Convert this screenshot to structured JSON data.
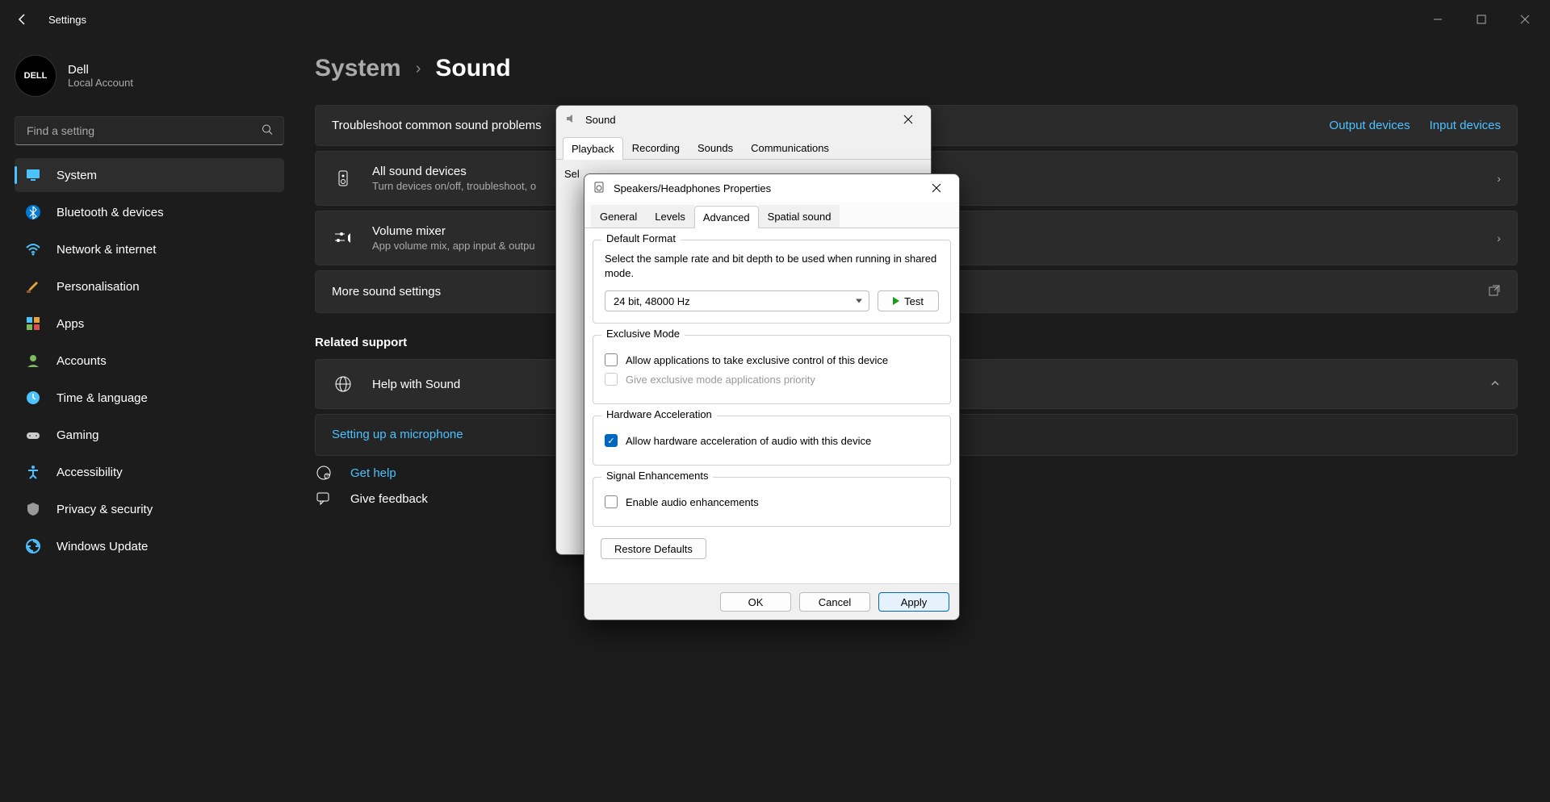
{
  "titlebar": {
    "title": "Settings"
  },
  "profile": {
    "name": "Dell",
    "sub": "Local Account",
    "avatar_text": "DELL"
  },
  "search": {
    "placeholder": "Find a setting"
  },
  "nav": [
    {
      "label": "System",
      "selected": true,
      "icon": "monitor"
    },
    {
      "label": "Bluetooth & devices",
      "icon": "bluetooth"
    },
    {
      "label": "Network & internet",
      "icon": "wifi"
    },
    {
      "label": "Personalisation",
      "icon": "brush"
    },
    {
      "label": "Apps",
      "icon": "apps"
    },
    {
      "label": "Accounts",
      "icon": "person"
    },
    {
      "label": "Time & language",
      "icon": "clock"
    },
    {
      "label": "Gaming",
      "icon": "gamepad"
    },
    {
      "label": "Accessibility",
      "icon": "accessibility"
    },
    {
      "label": "Privacy & security",
      "icon": "shield"
    },
    {
      "label": "Windows Update",
      "icon": "update"
    }
  ],
  "breadcrumb": {
    "parent": "System",
    "current": "Sound"
  },
  "troubleshoot": {
    "title": "Troubleshoot common sound problems",
    "link_output": "Output devices",
    "link_input": "Input devices"
  },
  "cards": {
    "all_devices": {
      "title": "All sound devices",
      "sub": "Turn devices on/off, troubleshoot, o"
    },
    "mixer": {
      "title": "Volume mixer",
      "sub": "App volume mix, app input & outpu"
    },
    "more": {
      "title": "More sound settings"
    }
  },
  "related": {
    "heading": "Related support",
    "help": "Help with Sound",
    "setup_mic": "Setting up a microphone",
    "get_help": "Get help",
    "feedback": "Give feedback"
  },
  "dlg_sound": {
    "title": "Sound",
    "tabs": [
      "Playback",
      "Recording",
      "Sounds",
      "Communications"
    ],
    "active_tab": 0,
    "body_hint": "Sel"
  },
  "dlg_props": {
    "title": "Speakers/Headphones Properties",
    "tabs": [
      "General",
      "Levels",
      "Advanced",
      "Spatial sound"
    ],
    "active_tab": 2,
    "groups": {
      "default_format": {
        "label": "Default Format",
        "desc": "Select the sample rate and bit depth to be used when running in shared mode.",
        "value": "24 bit, 48000 Hz",
        "test": "Test"
      },
      "exclusive": {
        "label": "Exclusive Mode",
        "chk1": "Allow applications to take exclusive control of this device",
        "chk2": "Give exclusive mode applications priority"
      },
      "hw": {
        "label": "Hardware Acceleration",
        "chk": "Allow hardware acceleration of audio with this device"
      },
      "signal": {
        "label": "Signal Enhancements",
        "chk": "Enable audio enhancements"
      }
    },
    "restore": "Restore Defaults",
    "buttons": {
      "ok": "OK",
      "cancel": "Cancel",
      "apply": "Apply"
    }
  }
}
